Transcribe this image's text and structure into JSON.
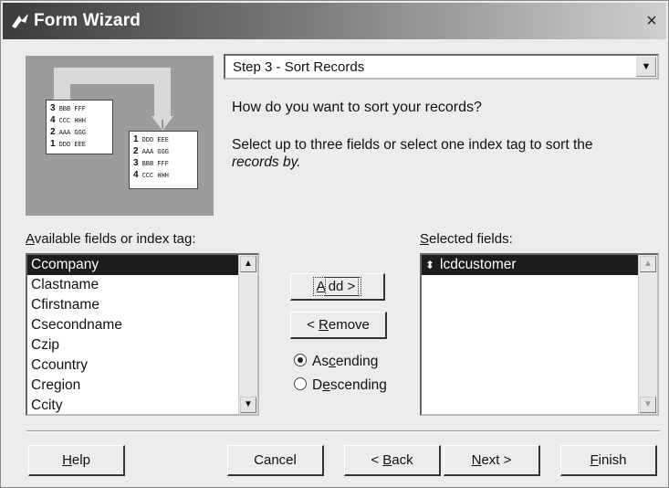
{
  "window": {
    "title": "Form Wizard",
    "close_glyph": "×"
  },
  "step": {
    "selected": "Step 3 - Sort Records",
    "dropdown_icon": "chevron-down-icon"
  },
  "question": "How do you want to sort your records?",
  "instruction": {
    "line1": "Select up to three fields or select one index tag to sort the",
    "line2": "records by."
  },
  "illustration": {
    "left_card": [
      {
        "n": "3",
        "t": "BBB FFF"
      },
      {
        "n": "4",
        "t": "CCC HHH"
      },
      {
        "n": "2",
        "t": "AAA GGG"
      },
      {
        "n": "1",
        "t": "DDD EEE"
      }
    ],
    "right_card": [
      {
        "n": "1",
        "t": "DDD EEE"
      },
      {
        "n": "2",
        "t": "AAA GGG"
      },
      {
        "n": "3",
        "t": "BBB FFF"
      },
      {
        "n": "4",
        "t": "CCC HHH"
      }
    ]
  },
  "available": {
    "label_first": "A",
    "label_rest": "vailable fields or index tag:",
    "items": [
      "Ccompany",
      "Clastname",
      "Cfirstname",
      "Csecondname",
      "Czip",
      "Ccountry",
      "Cregion",
      "Ccity"
    ],
    "selected_index": 0
  },
  "selected_fields": {
    "label_first": "S",
    "label_rest": "elected fields:",
    "items": [
      "lcdcustomer"
    ],
    "item_icon": "sort-direction-icon"
  },
  "buttons": {
    "add_first": "A",
    "add_rest": "dd >",
    "remove_prefix": "< ",
    "remove_first": "R",
    "remove_rest": "emove",
    "help_first": "H",
    "help_rest": "elp",
    "cancel": "Cancel",
    "back_prefix": "< ",
    "back_first": "B",
    "back_rest": "ack",
    "next_first": "N",
    "next_rest": "ext >",
    "finish_first": "F",
    "finish_rest": "inish"
  },
  "sort_order": {
    "ascending_a": "As",
    "ascending_u": "c",
    "ascending_b": "ending",
    "descending_a": "D",
    "descending_u": "e",
    "descending_b": "scending",
    "selected": "ascending"
  }
}
